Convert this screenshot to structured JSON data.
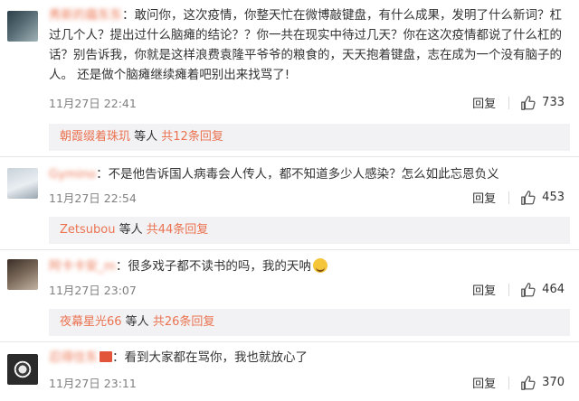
{
  "comments": [
    {
      "username": "秀新的霜东东",
      "text": "：敢问你，这次疫情，你整天忙在微博敲键盘，有什么成果，发明了什么新词？杠过几个人？提出过什么脑瘫的结论？？你一共在现实中待过几天？你在这次疫情都说了什么杠的话？别告诉我，你就是这样浪费袁隆平爷爷的粮食的，天天抱着键盘，志在成为一个没有脑子的人。 还是做个脑瘫继续瘫着吧别出来找骂了!",
      "time": "11月27日 22:41",
      "reply_label": "回复",
      "likes": "733",
      "sub": {
        "name": "朝霞缀着珠玑",
        "mid": " 等人 ",
        "count": "共12条回复"
      }
    },
    {
      "username": "Gymino",
      "text": "：不是他告诉国人病毒会人传人，都不知道多少人感染？怎么如此忘恩负义",
      "time": "11月27日 22:54",
      "reply_label": "回复",
      "likes": "453",
      "sub": {
        "name": "Zetsubou",
        "mid": " 等人 ",
        "count": "共44条回复"
      }
    },
    {
      "username": "阿卡卡安_m",
      "text": "：很多戏子都不读书的吗，我的天呐",
      "emoji": "face-emoji",
      "time": "11月27日 23:07",
      "reply_label": "回复",
      "likes": "464",
      "sub": {
        "name": "夜幕星光66",
        "mid": " 等人 ",
        "count": "共26条回复"
      }
    },
    {
      "username": "忍得住东",
      "text": "：看到大家都在骂你，我也就放心了",
      "time": "11月27日 23:11",
      "reply_label": "回复",
      "likes": "370"
    }
  ],
  "icons": {
    "like": "thumbs-up-icon"
  },
  "colors": {
    "accent": "#eb7350",
    "meta": "#808080",
    "subbox_bg": "#f2f2f5"
  }
}
